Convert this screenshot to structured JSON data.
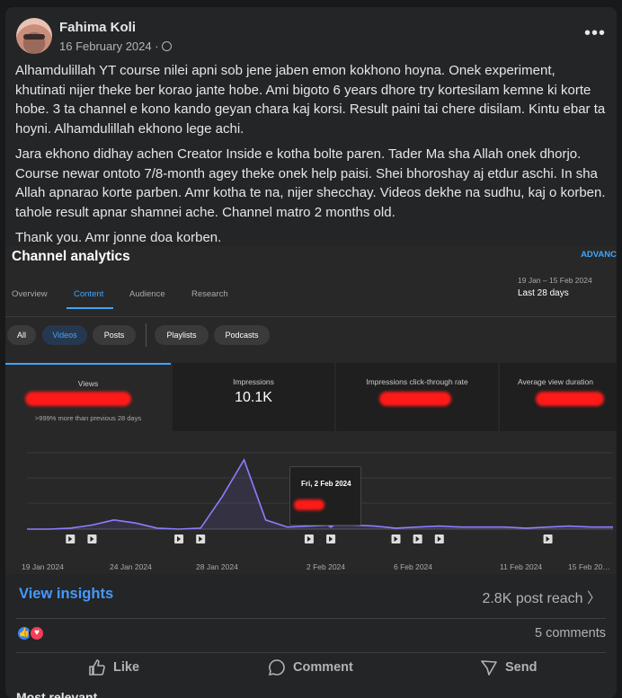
{
  "post": {
    "author": "Fahima Koli",
    "date": "16 February 2024 ·",
    "paragraphs": [
      "Alhamdulillah YT course nilei apni sob jene jaben emon kokhono hoyna. Onek experiment, khutinati nijer theke ber korao jante hobe. Ami bigoto 6 years dhore try kortesilam kemne ki korte hobe. 3 ta channel e kono kando geyan chara kaj korsi. Result paini tai chere disilam. Kintu ebar ta hoyni. Alhamdulillah ekhono lege achi.",
      "Jara ekhono didhay achen Creator Inside e kotha bolte paren. Tader Ma sha Allah onek dhorjo. Course newar ontoto 7/8-month agey theke onek help paisi. Shei bhoroshay aj etdur aschi. In sha Allah apnarao korte parben. Amr kotha te na, nijer shecchay. Videos dekhe na sudhu, kaj o korben. tahole result apnar shamnei ache. Channel matro 2 months old.",
      "Thank you. Amr jonne doa korben."
    ]
  },
  "analytics": {
    "title": "Channel analytics",
    "advanced": "ADVANC",
    "tabs": [
      "Overview",
      "Content",
      "Audience",
      "Research"
    ],
    "active_tab": "Content",
    "date_range": "19 Jan – 15 Feb 2024",
    "date_label": "Last 28 days",
    "chips": [
      "All",
      "Videos",
      "Posts",
      "Playlists",
      "Podcasts"
    ],
    "selected_chip": "Videos",
    "metrics": [
      {
        "label": "Views",
        "value": "",
        "sub": ">999% more than previous 28 days"
      },
      {
        "label": "Impressions",
        "value": "10.1K",
        "sub": ""
      },
      {
        "label": "Impressions click-through rate",
        "value": "",
        "sub": ""
      },
      {
        "label": "Average view duration",
        "value": "",
        "sub": ""
      }
    ],
    "tooltip_date": "Fri, 2 Feb 2024",
    "x_labels": [
      "19 Jan 2024",
      "24 Jan 2024",
      "28 Jan 2024",
      "2 Feb 2024",
      "6 Feb 2024",
      "11 Feb 2024",
      "15 Feb 20…"
    ]
  },
  "chart_data": {
    "type": "line",
    "title": "",
    "xlabel": "",
    "ylabel": "",
    "x": [
      "19 Jan",
      "20 Jan",
      "21 Jan",
      "22 Jan",
      "23 Jan",
      "24 Jan",
      "25 Jan",
      "26 Jan",
      "27 Jan",
      "28 Jan",
      "29 Jan",
      "30 Jan",
      "31 Jan",
      "1 Feb",
      "2 Feb",
      "3 Feb",
      "4 Feb",
      "5 Feb",
      "6 Feb",
      "7 Feb",
      "8 Feb",
      "9 Feb",
      "10 Feb",
      "11 Feb",
      "12 Feb",
      "13 Feb",
      "14 Feb",
      "15 Feb"
    ],
    "series": [
      {
        "name": "",
        "values": [
          0,
          0,
          1,
          4,
          9,
          6,
          1,
          0,
          1,
          32,
          68,
          9,
          2,
          3,
          4,
          4,
          3,
          1,
          2,
          3,
          2,
          2,
          2,
          1,
          2,
          3,
          2,
          2
        ]
      }
    ],
    "ylim": [
      0,
      75
    ],
    "grid": true,
    "color": "#8a7fff",
    "video_markers_x": [
      "21 Jan",
      "22 Jan",
      "26 Jan",
      "27 Jan",
      "1 Feb",
      "2 Feb",
      "5 Feb",
      "6 Feb",
      "7 Feb",
      "12 Feb"
    ]
  },
  "footer": {
    "view_insights": "View insights",
    "post_reach": "2.8K post reach",
    "comments": "5 comments",
    "actions": [
      "Like",
      "Comment",
      "Send"
    ],
    "most_relevant": "Most relevant"
  }
}
